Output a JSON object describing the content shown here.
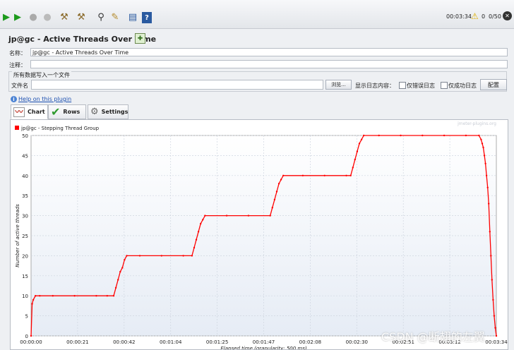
{
  "toolbar": {
    "buttons": [
      {
        "name": "start-icon",
        "glyph": "▶",
        "color": "#1c9a1c"
      },
      {
        "name": "start-no-pause-icon",
        "glyph": "▶",
        "color": "#1c9a1c"
      },
      {
        "name": "stop-icon",
        "glyph": "●",
        "color": "#aaaaaa"
      },
      {
        "name": "shutdown-icon",
        "glyph": "●",
        "color": "#bbbbbb"
      },
      {
        "name": "clear-icon",
        "glyph": "⚒",
        "color": "#8a6a2a"
      },
      {
        "name": "clear-all-icon",
        "glyph": "⚒",
        "color": "#8a6a2a"
      },
      {
        "name": "search-binoculars-icon",
        "glyph": "⚲",
        "color": "#333333"
      },
      {
        "name": "reset-search-icon",
        "glyph": "✎",
        "color": "#b48a2a"
      },
      {
        "name": "function-helper-icon",
        "glyph": "▤",
        "color": "#2a5aa0"
      },
      {
        "name": "help-icon",
        "glyph": "?",
        "color": "#1f4fa5"
      }
    ],
    "elapsed": "00:03:34",
    "warning_count": "0",
    "threads": "0/50",
    "warning_color": "#e0b000"
  },
  "header": {
    "title": "jp@gc - Active Threads Over Time"
  },
  "form": {
    "name_label": "名称：",
    "name_value": "jp@gc - Active Threads Over Time",
    "comment_label": "注释：",
    "comment_value": "",
    "group_title": "所有数据写入一个文件",
    "filename_label": "文件名",
    "filename_value": "",
    "browse_label": "浏览...",
    "log_label": "显示日志内容：",
    "errors_only_label": "仅错误日志",
    "success_only_label": "仅成功日志",
    "configure_label": "配置"
  },
  "help": {
    "link_text": "Help on this plugin"
  },
  "tabs": [
    {
      "label": "Chart",
      "icon": "chart-icon"
    },
    {
      "label": "Rows",
      "icon": "checkmark-icon"
    },
    {
      "label": "Settings",
      "icon": "gear-icon"
    }
  ],
  "chart_data": {
    "type": "line",
    "title": "",
    "watermark": "jmeter-plugins.org",
    "legend": [
      {
        "name": "jp@gc - Stepping Thread Group",
        "color": "#ff0000"
      }
    ],
    "legend_position": "top-left",
    "xlabel": "Elapsed time (granularity: 500 ms)",
    "ylabel": "Number of active threads",
    "ylim": [
      0,
      50
    ],
    "yticks": [
      0,
      5,
      10,
      15,
      20,
      25,
      30,
      35,
      40,
      45,
      50
    ],
    "xlim_seconds": [
      0,
      214
    ],
    "xtick_labels": [
      "00:00:00",
      "00:00:21",
      "00:00:42",
      "00:01:04",
      "00:01:25",
      "00:01:47",
      "00:02:08",
      "00:02:30",
      "00:02:51",
      "00:03:12",
      "00:03:34"
    ],
    "grid": true,
    "series": [
      {
        "name": "jp@gc - Stepping Thread Group",
        "color": "#ff0000",
        "points": [
          [
            0,
            0
          ],
          [
            0.5,
            8
          ],
          [
            1,
            9
          ],
          [
            2,
            10
          ],
          [
            4,
            10
          ],
          [
            10,
            10
          ],
          [
            20,
            10
          ],
          [
            30,
            10
          ],
          [
            35,
            10
          ],
          [
            38,
            10
          ],
          [
            39,
            12
          ],
          [
            40,
            14
          ],
          [
            41,
            16
          ],
          [
            42,
            17
          ],
          [
            43,
            19
          ],
          [
            44,
            20
          ],
          [
            50,
            20
          ],
          [
            60,
            20
          ],
          [
            70,
            20
          ],
          [
            74,
            20
          ],
          [
            75,
            22
          ],
          [
            76,
            24
          ],
          [
            77,
            26
          ],
          [
            78,
            28
          ],
          [
            79,
            29
          ],
          [
            80,
            30
          ],
          [
            90,
            30
          ],
          [
            100,
            30
          ],
          [
            110,
            30
          ],
          [
            111,
            32
          ],
          [
            112,
            34
          ],
          [
            113,
            36
          ],
          [
            114,
            38
          ],
          [
            115,
            39
          ],
          [
            116,
            40
          ],
          [
            125,
            40
          ],
          [
            135,
            40
          ],
          [
            145,
            40
          ],
          [
            147,
            40
          ],
          [
            148,
            42
          ],
          [
            149,
            44
          ],
          [
            150,
            46
          ],
          [
            151,
            48
          ],
          [
            152,
            49
          ],
          [
            153,
            50
          ],
          [
            160,
            50
          ],
          [
            170,
            50
          ],
          [
            180,
            50
          ],
          [
            190,
            50
          ],
          [
            200,
            50
          ],
          [
            206,
            50
          ],
          [
            207,
            49
          ],
          [
            207.5,
            48
          ],
          [
            208,
            47
          ],
          [
            208.5,
            45
          ],
          [
            209,
            43
          ],
          [
            209.5,
            40
          ],
          [
            210,
            37
          ],
          [
            210.5,
            33
          ],
          [
            211,
            26
          ],
          [
            211.5,
            20
          ],
          [
            212,
            14
          ],
          [
            212.5,
            9
          ],
          [
            213,
            5
          ],
          [
            213.5,
            2
          ],
          [
            214,
            0
          ]
        ]
      }
    ]
  },
  "watermark": {
    "text": "CSDN @断翅的左翼"
  }
}
